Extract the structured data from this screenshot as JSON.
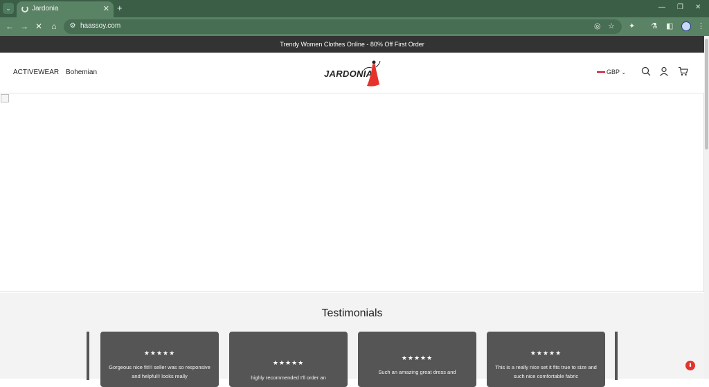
{
  "browser": {
    "tab_title": "Jardonia",
    "url": "haassoy.com"
  },
  "announcement": "Trendy Women Clothes Online - 80% Off First Order",
  "nav": {
    "items": [
      {
        "label": "ACTIVEWEAR"
      },
      {
        "label": "Bohemian"
      }
    ]
  },
  "brand": {
    "logo_text": "JARDONIA",
    "accent_color": "#e5322d"
  },
  "header": {
    "currency": "GBP"
  },
  "testimonials": {
    "title": "Testimonials",
    "cards": [
      {
        "stars": "★★★★★",
        "quote": "Gorgeous nice fit!!! seller was so responsive and helpful!! looks really"
      },
      {
        "stars": "★★★★★",
        "quote": "highly recommended I'll order an"
      },
      {
        "stars": "★★★★★",
        "quote": "Such an amazing great dress and"
      },
      {
        "stars": "★★★★★",
        "quote": "This is a really nice set it fits true to size and such nice comfortable fabric"
      }
    ]
  },
  "icons": {
    "search": "search-icon",
    "account": "user-icon",
    "cart": "cart-icon"
  }
}
